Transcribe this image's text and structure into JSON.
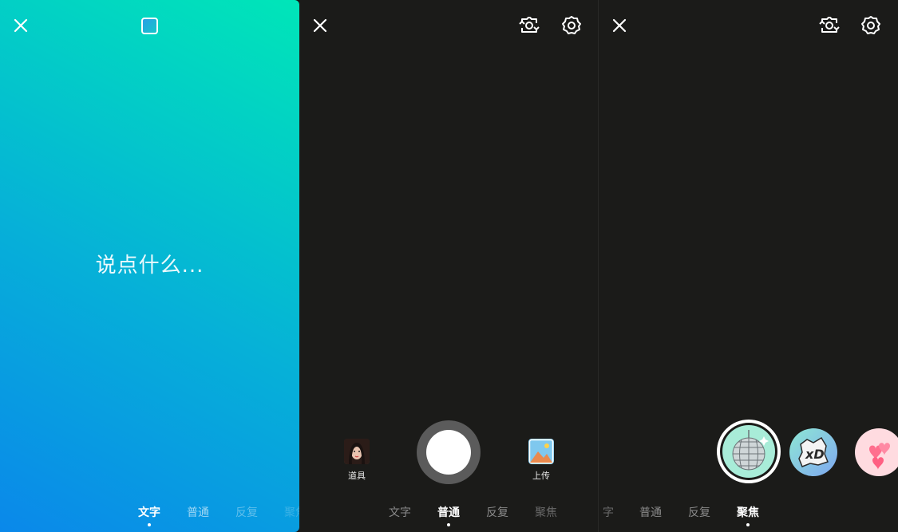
{
  "text_mode": {
    "placeholder": "说点什么..."
  },
  "text_mode_modes": [
    "文字",
    "普通",
    "反复",
    "聚焦"
  ],
  "camera_modes": [
    "文字",
    "普通",
    "反复",
    "聚焦"
  ],
  "focus_modes": [
    "字",
    "普通",
    "反复",
    "聚焦"
  ],
  "camera": {
    "props_label": "道具",
    "upload_label": "上传"
  },
  "colors": {
    "gradient_start": "#0a88ea",
    "gradient_end": "#00e6b8",
    "active_mode": "#ffffff",
    "inactive_mode": "#9a9a9a"
  },
  "icons": [
    "close-icon",
    "color-square-icon",
    "flip-camera-icon",
    "settings-icon",
    "disco-ball-effect-icon",
    "xd-sticker-effect-icon",
    "hearts-effect-icon"
  ]
}
